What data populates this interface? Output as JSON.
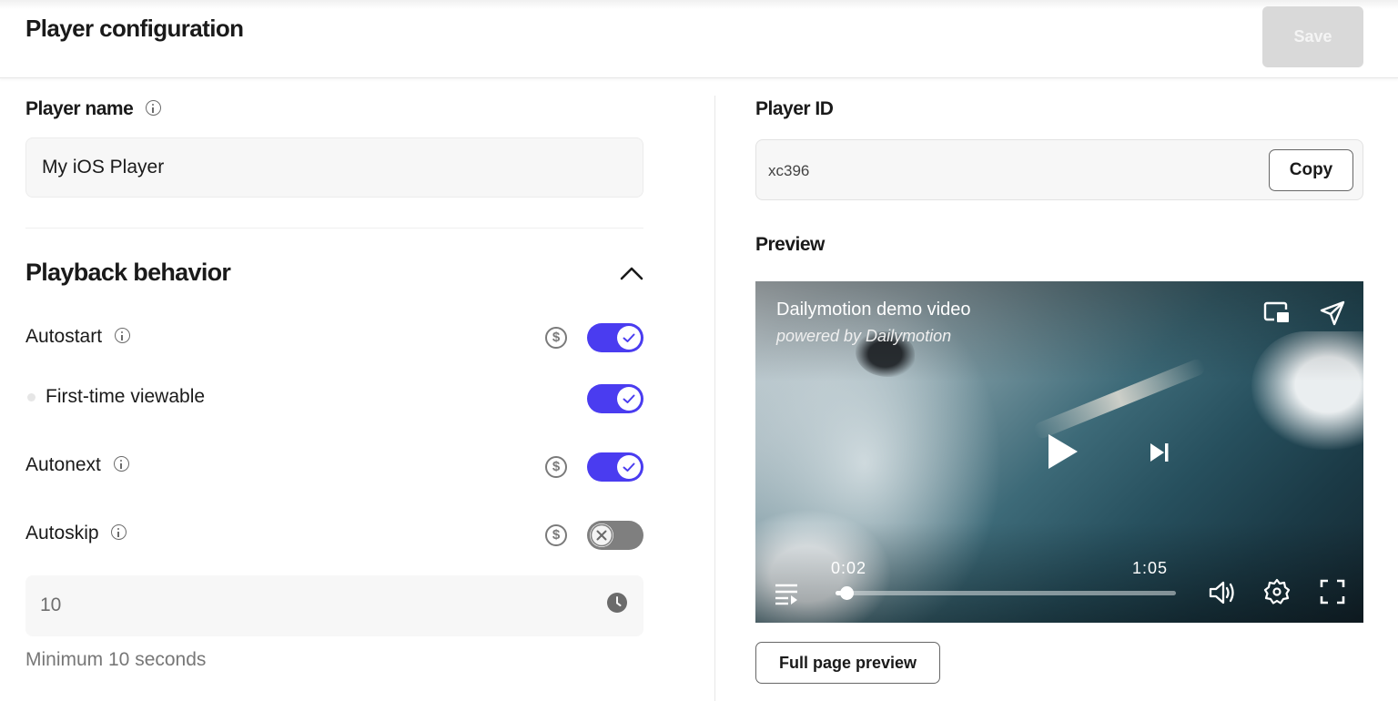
{
  "header": {
    "title": "Player configuration",
    "save_label": "Save"
  },
  "player_name": {
    "label": "Player name",
    "value": "My iOS Player"
  },
  "playback": {
    "title": "Playback behavior",
    "expanded": true,
    "rows": [
      {
        "label": "Autostart",
        "has_info": true,
        "monetization_icon": true,
        "enabled": true
      },
      {
        "label": "First-time viewable",
        "has_info": false,
        "monetization_icon": false,
        "enabled": true
      },
      {
        "label": "Autonext",
        "has_info": true,
        "monetization_icon": true,
        "enabled": true
      },
      {
        "label": "Autoskip",
        "has_info": true,
        "monetization_icon": true,
        "enabled": false
      }
    ],
    "autoskip_seconds": "10",
    "autoskip_helper": "Minimum 10 seconds"
  },
  "player_id": {
    "label": "Player ID",
    "value": "xc396",
    "copy_label": "Copy"
  },
  "preview": {
    "label": "Preview",
    "video_title": "Dailymotion demo video",
    "video_subtitle": "powered by Dailymotion",
    "current_time": "0:02",
    "duration": "1:05",
    "progress_fraction": 0.031,
    "full_page_label": "Full page preview"
  },
  "colors": {
    "accent": "#4a3cf0",
    "toggle_off": "#7f7f7f",
    "save_disabled": "#d9d9d9"
  },
  "icons": {
    "dollar": "$"
  }
}
